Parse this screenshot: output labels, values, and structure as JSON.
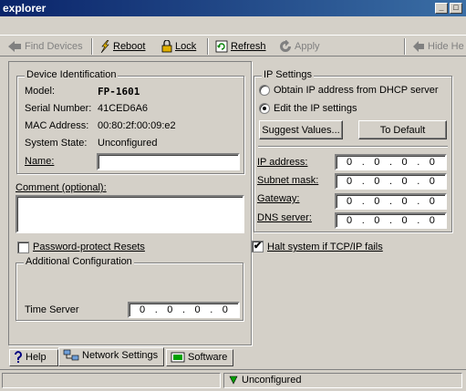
{
  "window": {
    "title": "explorer",
    "minimize": "_",
    "restore": "□"
  },
  "toolbar": {
    "find_devices": "Find Devices",
    "reboot": "Reboot",
    "lock": "Lock",
    "refresh": "Refresh",
    "apply": "Apply",
    "hide_help": "Hide He"
  },
  "device": {
    "legend": "Device Identification",
    "model_label": "Model:",
    "model_value": "FP-1601",
    "serial_label": "Serial Number:",
    "serial_value": "41CED6A6",
    "mac_label": "MAC Address:",
    "mac_value": "00:80:2f:00:09:e2",
    "state_label": "System State:",
    "state_value": "Unconfigured",
    "name_label": "Name:",
    "name_value": ""
  },
  "comment": {
    "label": "Comment (optional):",
    "value": ""
  },
  "password_reset": {
    "label": "Password-protect Resets",
    "checked": false
  },
  "additional": {
    "legend": "Additional Configuration",
    "time_server_label": "Time Server",
    "time_server": [
      "0",
      "0",
      "0",
      "0"
    ]
  },
  "ip": {
    "legend": "IP Settings",
    "dhcp_option": "Obtain IP address from DHCP server",
    "edit_option": "Edit  the IP settings",
    "selected": "edit",
    "suggest_button": "Suggest Values...",
    "default_button": "To Default",
    "address_label": "IP address:",
    "address": [
      "0",
      "0",
      "0",
      "0"
    ],
    "subnet_label": "Subnet mask:",
    "subnet": [
      "0",
      "0",
      "0",
      "0"
    ],
    "gateway_label": "Gateway:",
    "gateway": [
      "0",
      "0",
      "0",
      "0"
    ],
    "dns_label": "DNS server:",
    "dns": [
      "0",
      "0",
      "0",
      "0"
    ]
  },
  "halt": {
    "label": "Halt system if TCP/IP fails",
    "checked": true
  },
  "tabs": [
    {
      "label": "Help",
      "icon": "help-icon"
    },
    {
      "label": "Network Settings",
      "icon": "network-icon"
    },
    {
      "label": "Software",
      "icon": "software-icon"
    }
  ],
  "status": {
    "text": "Unconfigured",
    "icon": "device-status-icon"
  }
}
